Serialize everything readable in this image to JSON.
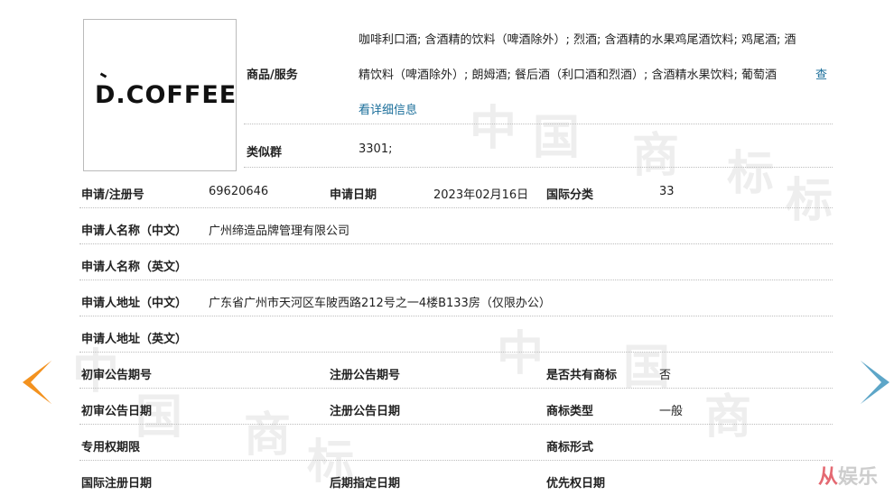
{
  "watermark_chars": [
    "中",
    "国",
    "商",
    "标",
    "中",
    "国",
    "商",
    "标",
    "中",
    "国",
    "商",
    "标",
    "中",
    "国"
  ],
  "logo": {
    "text": "D.COFFEE"
  },
  "goods": {
    "label": "商品/服务",
    "lines": [
      "咖啡利口酒; 含酒精的饮料（啤酒除外）; 烈酒; 含酒精的水果鸡尾酒饮料; 鸡尾酒; 酒",
      "精饮料（啤酒除外）; 朗姆酒; 餐后酒（利口酒和烈酒）; 含酒精水果饮料; 葡萄酒"
    ],
    "link_part1": "查",
    "link_part2": "看详细信息"
  },
  "similar_group": {
    "label": "类似群",
    "value": "3301;"
  },
  "rows": {
    "reg_no_label": "申请/注册号",
    "reg_no": "69620646",
    "app_date_label": "申请日期",
    "app_date": "2023年02月16日",
    "intl_class_label": "国际分类",
    "intl_class": "33",
    "applicant_cn_label": "申请人名称（中文）",
    "applicant_cn": "广州缔造品牌管理有限公司",
    "applicant_en_label": "申请人名称（英文）",
    "address_cn_label": "申请人地址（中文）",
    "address_cn": "广东省广州市天河区车陂西路212号之一4楼B133房（仅限办公）",
    "address_en_label": "申请人地址（英文）",
    "prelim_no_label": "初审公告期号",
    "reg_ann_no_label": "注册公告期号",
    "shared_label": "是否共有商标",
    "shared": "否",
    "prelim_date_label": "初审公告日期",
    "reg_ann_date_label": "注册公告日期",
    "tm_type_label": "商标类型",
    "tm_type": "一般",
    "exclusive_label": "专用权期限",
    "tm_form_label": "商标形式",
    "intl_reg_date_label": "国际注册日期",
    "later_date_label": "后期指定日期",
    "priority_label": "优先权日期"
  },
  "corner_watermark": {
    "symbol": "从",
    "text": "娱乐"
  },
  "colors": {
    "left_arrow": "#f3921f",
    "right_arrow": "#5da6c8",
    "link": "#1a6e9a"
  }
}
